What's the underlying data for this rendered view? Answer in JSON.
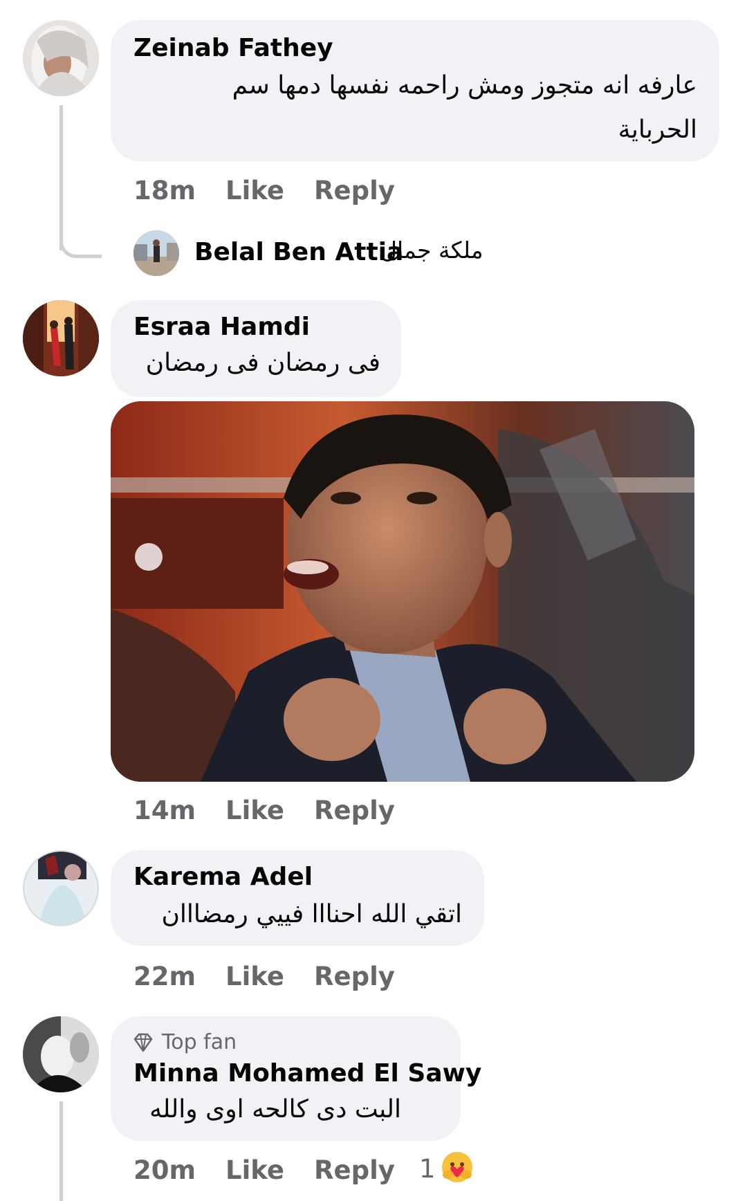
{
  "comments": [
    {
      "author": "Zeinab Fathey",
      "text_line1": "عارفه انه متجوز ومش راحمه نفسها دمها سم",
      "text_line2": "الحرباية",
      "time": "18m",
      "like_label": "Like",
      "reply_label": "Reply"
    },
    {
      "author": "Esraa Hamdi",
      "text": "فى رمضان فى رمضان",
      "time": "14m",
      "like_label": "Like",
      "reply_label": "Reply"
    },
    {
      "author": "Karema Adel",
      "text": "اتقي الله احنااا فييي رمضااان",
      "time": "22m",
      "like_label": "Like",
      "reply_label": "Reply"
    },
    {
      "badge": "Top fan",
      "author": "Minna Mohamed El Sawy",
      "text": "البت دى كالحه اوى والله",
      "time": "20m",
      "like_label": "Like",
      "reply_label": "Reply",
      "reaction_count": "1"
    }
  ],
  "reply_preview": {
    "author": "Belal Ben Attia",
    "text": "ملكة جمال"
  },
  "colors": {
    "bubble": "#f0f2f5",
    "meta": "#65676b",
    "text": "#050505",
    "thread": "#ced0d4"
  },
  "icons": {
    "badge": "diamond-icon",
    "reaction": "care-reaction-icon"
  }
}
